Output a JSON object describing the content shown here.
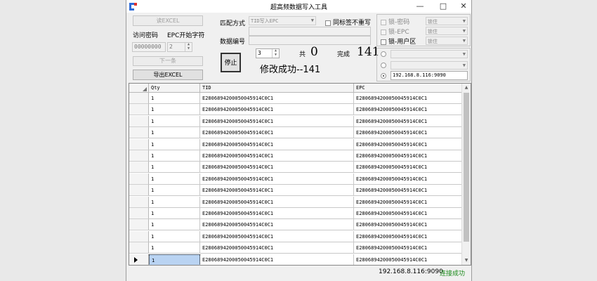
{
  "window": {
    "title": "超高频数据写入工具",
    "minimize": "—",
    "maximize": "□",
    "close": "✕"
  },
  "left": {
    "read_excel": "读EXCEL",
    "access_pwd_label": "访问密码",
    "epc_start_label": "EPC开始字符",
    "access_pwd_value": "00000000",
    "epc_start_value": "2",
    "next_button": "下一条",
    "export_button": "导出EXCEL"
  },
  "mid": {
    "match_label": "匹配方式",
    "match_value": "TID写入EPC",
    "unique_label": "同标签不重写",
    "data_label": "数据编号",
    "stop_button": "停止",
    "count_value": "3",
    "total_label": "共",
    "total_value": "0",
    "done_label": "完成",
    "done_value": "141",
    "message": "修改成功--141"
  },
  "right": {
    "lock_pwd": "锁-密码",
    "lock_epc": "锁-EPC",
    "lock_user": "锁-用户区",
    "lock_pwd_mode": "锁住",
    "lock_epc_mode": "锁住",
    "lock_user_mode": "锁住",
    "ip_address": "192.168.8.116:9090"
  },
  "table": {
    "headers": [
      "Qty",
      "TID",
      "EPC"
    ],
    "rows": [
      [
        "1",
        "E2806894200050045914C0C1",
        "E2806894200050045914C0C1"
      ],
      [
        "1",
        "E2806894200050045914C0C1",
        "E2806894200050045914C0C1"
      ],
      [
        "1",
        "E2806894200050045914C0C1",
        "E2806894200050045914C0C1"
      ],
      [
        "1",
        "E2806894200050045914C0C1",
        "E2806894200050045914C0C1"
      ],
      [
        "1",
        "E2806894200050045914C0C1",
        "E2806894200050045914C0C1"
      ],
      [
        "1",
        "E2806894200050045914C0C1",
        "E2806894200050045914C0C1"
      ],
      [
        "1",
        "E2806894200050045914C0C1",
        "E2806894200050045914C0C1"
      ],
      [
        "1",
        "E2806894200050045914C0C1",
        "E2806894200050045914C0C1"
      ],
      [
        "1",
        "E2806894200050045914C0C1",
        "E2806894200050045914C0C1"
      ],
      [
        "1",
        "E2806894200050045914C0C1",
        "E2806894200050045914C0C1"
      ],
      [
        "1",
        "E2806894200050045914C0C1",
        "E2806894200050045914C0C1"
      ],
      [
        "1",
        "E2806894200050045914C0C1",
        "E2806894200050045914C0C1"
      ],
      [
        "1",
        "E2806894200050045914C0C1",
        "E2806894200050045914C0C1"
      ],
      [
        "1",
        "E2806894200050045914C0C1",
        "E2806894200050045914C0C1"
      ],
      [
        "1",
        "E2806894200050045914C0C1",
        "E2806894200050045914C0C1"
      ]
    ],
    "selected_row": 14
  },
  "status": {
    "address": "192.168.8.116:9090",
    "connection": "连接成功",
    "connection_color": "#1a8a1a"
  }
}
